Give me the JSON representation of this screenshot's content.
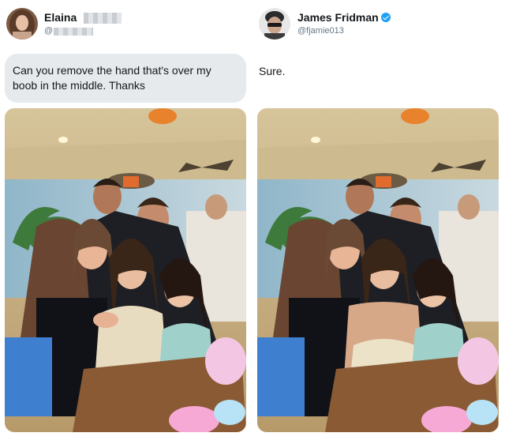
{
  "left_tweet": {
    "user_name": "Elaina",
    "handle": "@",
    "message": "Can you remove the hand that's over my boob in the middle. Thanks",
    "avatar_icon": "user-avatar-icon"
  },
  "right_tweet": {
    "user_name": "James Fridman",
    "handle": "@fjamie013",
    "reply": "Sure.",
    "verified_icon": "verified-badge-icon",
    "accent_color": "#1da1f2"
  },
  "photos": {
    "before": "group-photo-original",
    "after": "group-photo-edited"
  }
}
